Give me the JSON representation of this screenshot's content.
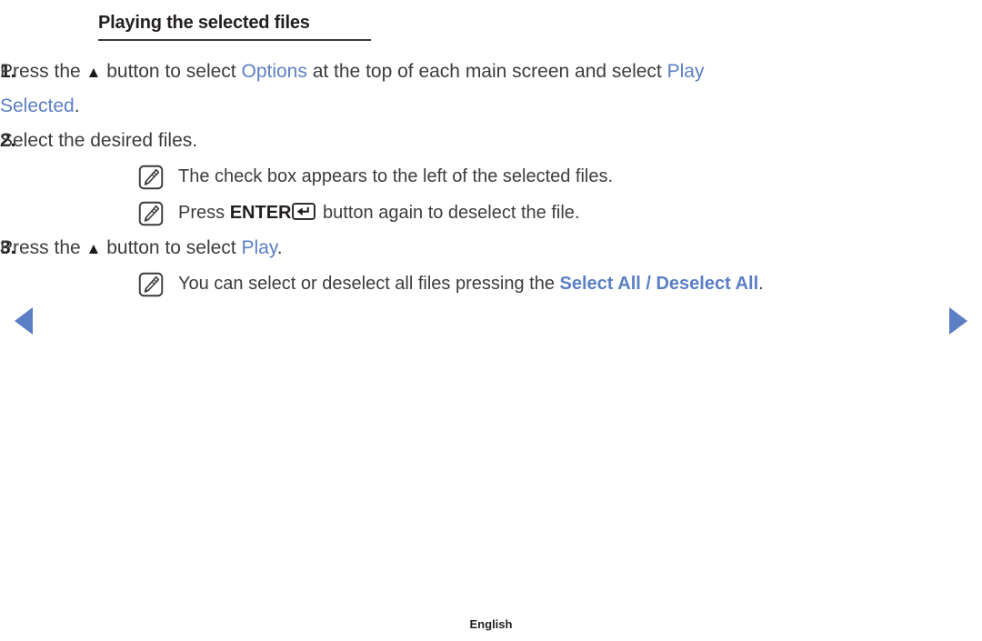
{
  "page": {
    "heading": "Playing the selected files",
    "footer_label": "English",
    "background_color": "#ffffff",
    "text_color": "#3c3c3c",
    "accent_color": "#5b7fc4"
  },
  "nav": {
    "prev_icon": "triangle-left-icon",
    "next_icon": "triangle-right-icon"
  },
  "steps": [
    {
      "number": "1.",
      "segments": [
        {
          "type": "text",
          "value": "Press the "
        },
        {
          "type": "glyph",
          "value": "▲",
          "name": "up-arrow-button-glyph"
        },
        {
          "type": "text",
          "value": " button to select "
        },
        {
          "type": "blue",
          "value": "Options"
        },
        {
          "type": "text",
          "value": " at the top of each main screen and select "
        },
        {
          "type": "blue",
          "value": "Play Selected"
        },
        {
          "type": "text",
          "value": "."
        }
      ],
      "notes": []
    },
    {
      "number": "2.",
      "segments": [
        {
          "type": "text",
          "value": "Select the desired files."
        }
      ],
      "notes": [
        {
          "icon": "note-pencil-icon",
          "segments": [
            {
              "type": "text",
              "value": "The check box appears to the left of the selected files."
            }
          ]
        },
        {
          "icon": "note-pencil-icon",
          "segments": [
            {
              "type": "text",
              "value": "Press "
            },
            {
              "type": "bold",
              "value": "ENTER"
            },
            {
              "type": "enterkey",
              "value": "↵",
              "name": "enter-key-glyph"
            },
            {
              "type": "text",
              "value": " button again to deselect the file."
            }
          ]
        }
      ]
    },
    {
      "number": "3.",
      "segments": [
        {
          "type": "text",
          "value": "Press the "
        },
        {
          "type": "glyph",
          "value": "▲",
          "name": "up-arrow-button-glyph"
        },
        {
          "type": "text",
          "value": " button to select "
        },
        {
          "type": "blue",
          "value": "Play"
        },
        {
          "type": "text",
          "value": "."
        }
      ],
      "notes": [
        {
          "icon": "note-pencil-icon",
          "segments": [
            {
              "type": "text",
              "value": "You can select or deselect all files pressing the "
            },
            {
              "type": "blue-bold",
              "value": "Select All / Deselect All"
            },
            {
              "type": "text",
              "value": "."
            }
          ]
        }
      ]
    }
  ]
}
